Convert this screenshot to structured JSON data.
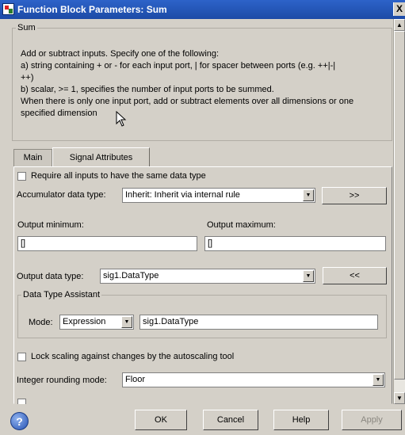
{
  "window": {
    "title": "Function Block Parameters: Sum",
    "close": "X"
  },
  "group": {
    "label": "Sum"
  },
  "description": [
    "Add or subtract inputs.  Specify one of the following:",
    "a) string containing + or - for each input port, | for spacer between ports (e.g. ++|-|",
    "++)",
    "b) scalar, >= 1, specifies the number of input ports to be summed.",
    "When there is only one input port, add or subtract elements over all dimensions or one",
    "specified dimension"
  ],
  "tabs": [
    {
      "label": "Main",
      "active": false
    },
    {
      "label": "Signal Attributes",
      "active": true
    }
  ],
  "signal": {
    "require_same_type": {
      "label": "Require all inputs to have the same data type",
      "checked": false
    },
    "accumulator": {
      "label": "Accumulator data type:",
      "value": "Inherit: Inherit via internal rule",
      "button": ">>"
    },
    "output_min": {
      "label": "Output minimum:",
      "value": "[]"
    },
    "output_max": {
      "label": "Output maximum:",
      "value": "[]"
    },
    "output_type": {
      "label": "Output data type:",
      "value": "sig1.DataType",
      "button": "<<"
    },
    "assistant": {
      "label": "Data Type Assistant",
      "mode_label": "Mode:",
      "mode_value": "Expression",
      "expression_value": "sig1.DataType"
    },
    "lock_scaling": {
      "label": "Lock scaling against changes by the autoscaling tool",
      "checked": false
    },
    "rounding": {
      "label": "Integer rounding mode:",
      "value": "Floor"
    }
  },
  "footer": {
    "ok": "OK",
    "cancel": "Cancel",
    "help": "Help",
    "apply": "Apply"
  },
  "icons": {
    "app": "simulink-block-icon",
    "help": "help-icon",
    "dropdown": "chevron-down-icon",
    "scroll_up": "arrow-up-icon",
    "scroll_down": "arrow-down-icon",
    "cursor": "mouse-pointer-icon"
  },
  "colors": {
    "titlebar": "#1c4aa6",
    "dialog": "#d4d0c8"
  }
}
